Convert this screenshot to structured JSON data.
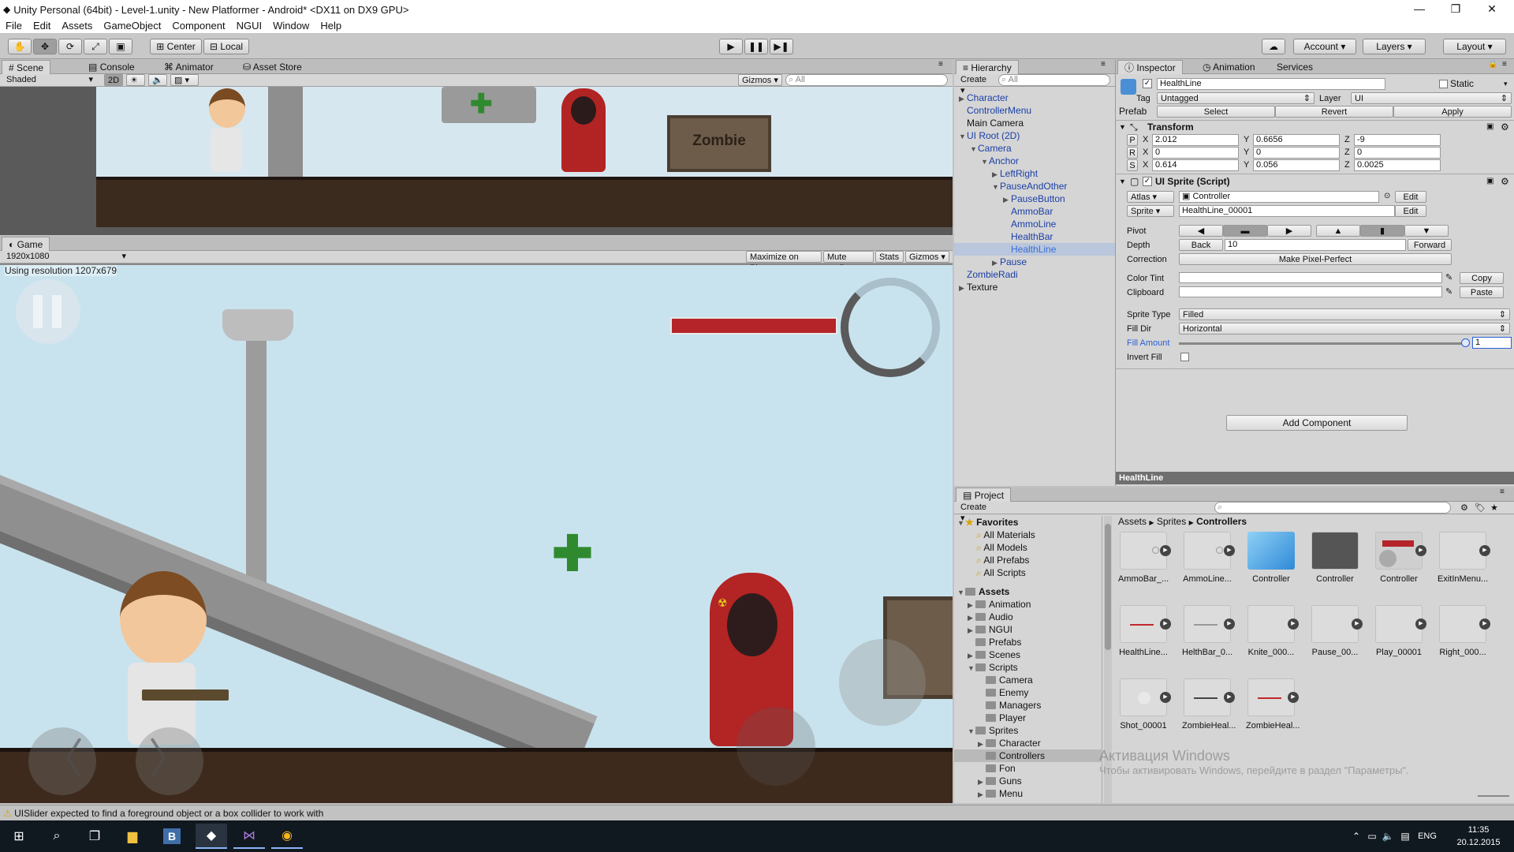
{
  "window": {
    "title": "Unity Personal (64bit) - Level-1.unity - New Platformer - Android* <DX11 on DX9 GPU>"
  },
  "menu": [
    "File",
    "Edit",
    "Assets",
    "GameObject",
    "Component",
    "NGUI",
    "Window",
    "Help"
  ],
  "toolbar": {
    "center": "Center",
    "local": "Local",
    "account": "Account",
    "layers": "Layers",
    "layout": "Layout"
  },
  "scene": {
    "tabs": [
      "Scene",
      "Console",
      "Animator",
      "Asset Store"
    ],
    "shading": "Shaded",
    "mode2d": "2D",
    "gizmos": "Gizmos",
    "search_placeholder": "All",
    "sign": "Zombie"
  },
  "game": {
    "tab": "Game",
    "resolution": "1920x1080",
    "using_resolution": "Using resolution 1207x679",
    "buttons": [
      "Maximize on Play",
      "Mute audio",
      "Stats",
      "Gizmos"
    ]
  },
  "hierarchy": {
    "tab": "Hierarchy",
    "create": "Create",
    "search_placeholder": "All",
    "items": [
      {
        "label": "Character",
        "depth": 0,
        "arrow": "▶"
      },
      {
        "label": "ControllerMenu",
        "depth": 0,
        "arrow": ""
      },
      {
        "label": "Main Camera",
        "depth": 0,
        "arrow": "",
        "color": "#111"
      },
      {
        "label": "UI Root (2D)",
        "depth": 0,
        "arrow": "▼"
      },
      {
        "label": "Camera",
        "depth": 1,
        "arrow": "▼"
      },
      {
        "label": "Anchor",
        "depth": 2,
        "arrow": "▼"
      },
      {
        "label": "LeftRight",
        "depth": 3,
        "arrow": "▶"
      },
      {
        "label": "PauseAndOther",
        "depth": 3,
        "arrow": "▼"
      },
      {
        "label": "PauseButton",
        "depth": 4,
        "arrow": "▶"
      },
      {
        "label": "AmmoBar",
        "depth": 4,
        "arrow": ""
      },
      {
        "label": "AmmoLine",
        "depth": 4,
        "arrow": ""
      },
      {
        "label": "HealthBar",
        "depth": 4,
        "arrow": ""
      },
      {
        "label": "HealthLine",
        "depth": 4,
        "arrow": "",
        "selected": true
      },
      {
        "label": "Pause",
        "depth": 3,
        "arrow": "▶"
      },
      {
        "label": "ZombieRadi",
        "depth": 0,
        "arrow": ""
      },
      {
        "label": "Texture",
        "depth": 0,
        "arrow": "▶",
        "color": "#111"
      }
    ]
  },
  "inspector": {
    "tabs": [
      "Inspector",
      "Animation",
      "Services"
    ],
    "object_name": "HealthLine",
    "static_label": "Static",
    "tag_label": "Tag",
    "tag": "Untagged",
    "layer_label": "Layer",
    "layer": "UI",
    "prefab_label": "Prefab",
    "prefab_buttons": [
      "Select",
      "Revert",
      "Apply"
    ],
    "transform": {
      "title": "Transform",
      "rows": [
        {
          "key": "P",
          "x": "2.012",
          "y": "0.6656",
          "z": "-9"
        },
        {
          "key": "R",
          "x": "0",
          "y": "0",
          "z": "0"
        },
        {
          "key": "S",
          "x": "0.614",
          "y": "0.056",
          "z": "0.0025"
        }
      ]
    },
    "sprite": {
      "title": "UI Sprite (Script)",
      "atlas_btn": "Atlas",
      "atlas": "Controller",
      "sprite_btn": "Sprite",
      "sprite": "HealthLine_00001",
      "edit": "Edit",
      "pivot": "Pivot",
      "depth": "Depth",
      "back": "Back",
      "depth_value": "10",
      "forward": "Forward",
      "correction": "Correction",
      "make_pixel_perfect": "Make Pixel-Perfect",
      "color_tint": "Color Tint",
      "clipboard": "Clipboard",
      "copy": "Copy",
      "paste": "Paste",
      "sprite_type_label": "Sprite Type",
      "sprite_type": "Filled",
      "fill_dir_label": "Fill Dir",
      "fill_dir": "Horizontal",
      "fill_amount_label": "Fill Amount",
      "fill_amount": "1",
      "invert_fill": "Invert Fill"
    },
    "add_component": "Add Component",
    "footer": "HealthLine"
  },
  "project": {
    "tab": "Project",
    "create": "Create",
    "breadcrumb": [
      "Assets",
      "Sprites",
      "Controllers"
    ],
    "favorites": {
      "label": "Favorites",
      "items": [
        "All Materials",
        "All Models",
        "All Prefabs",
        "All Scripts"
      ]
    },
    "assets_label": "Assets",
    "tree": [
      {
        "label": "Animation",
        "depth": 1,
        "arrow": "▶"
      },
      {
        "label": "Audio",
        "depth": 1,
        "arrow": "▶"
      },
      {
        "label": "NGUI",
        "depth": 1,
        "arrow": "▶"
      },
      {
        "label": "Prefabs",
        "depth": 1,
        "arrow": ""
      },
      {
        "label": "Scenes",
        "depth": 1,
        "arrow": "▶"
      },
      {
        "label": "Scripts",
        "depth": 1,
        "arrow": "▼"
      },
      {
        "label": "Camera",
        "depth": 2,
        "arrow": ""
      },
      {
        "label": "Enemy",
        "depth": 2,
        "arrow": ""
      },
      {
        "label": "Managers",
        "depth": 2,
        "arrow": ""
      },
      {
        "label": "Player",
        "depth": 2,
        "arrow": ""
      },
      {
        "label": "Sprites",
        "depth": 1,
        "arrow": "▼"
      },
      {
        "label": "Character",
        "depth": 2,
        "arrow": "▶"
      },
      {
        "label": "Controllers",
        "depth": 2,
        "arrow": "",
        "selected": true
      },
      {
        "label": "Fon",
        "depth": 2,
        "arrow": ""
      },
      {
        "label": "Guns",
        "depth": 2,
        "arrow": "▶"
      },
      {
        "label": "Menu",
        "depth": 2,
        "arrow": "▶"
      }
    ],
    "assets": [
      {
        "label": "AmmoBar_...",
        "kind": "ring"
      },
      {
        "label": "AmmoLine...",
        "kind": "ring"
      },
      {
        "label": "Controller",
        "kind": "cube"
      },
      {
        "label": "Controller",
        "kind": "dark"
      },
      {
        "label": "Controller",
        "kind": "atlas"
      },
      {
        "label": "ExitInMenu...",
        "kind": "blank"
      },
      {
        "label": "HealthLine...",
        "kind": "redline"
      },
      {
        "label": "HelthBar_0...",
        "kind": "grayline"
      },
      {
        "label": "Knite_000...",
        "kind": "blank"
      },
      {
        "label": "Pause_00...",
        "kind": "blank"
      },
      {
        "label": "Play_00001",
        "kind": "blank"
      },
      {
        "label": "Right_000...",
        "kind": "blank"
      },
      {
        "label": "Shot_00001",
        "kind": "circle"
      },
      {
        "label": "ZombieHeal...",
        "kind": "darkline"
      },
      {
        "label": "ZombieHeal...",
        "kind": "redline"
      }
    ],
    "watermark_title": "Активация Windows",
    "watermark_text": "Чтобы активировать Windows, перейдите в раздел \"Параметры\"."
  },
  "status": {
    "message": "UISlider expected to find a foreground object or a box collider to work with"
  },
  "taskbar": {
    "time": "11:35",
    "date": "20.12.2015",
    "lang": "ENG"
  }
}
